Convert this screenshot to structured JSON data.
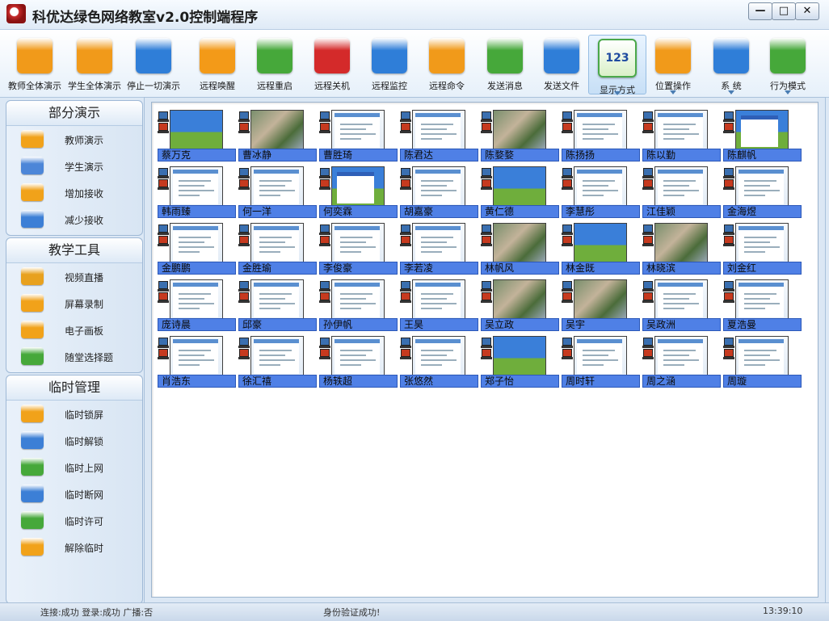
{
  "window": {
    "title": "科优达绿色网络教室v2.0控制端程序",
    "controls": {
      "minimize": "—",
      "maximize": "□",
      "close": "✕"
    }
  },
  "toolbar": [
    {
      "label": "教师全体演示",
      "icon": "teacher-broadcast-icon",
      "color": "#f19a1a"
    },
    {
      "label": "学生全体演示",
      "icon": "student-broadcast-icon",
      "color": "#f19a1a"
    },
    {
      "label": "停止一切演示",
      "icon": "stop-all-icon",
      "color": "#2f7ed8"
    },
    {
      "label": "远程唤醒",
      "icon": "wake-icon",
      "color": "#f39a18"
    },
    {
      "label": "远程重启",
      "icon": "restart-icon",
      "color": "#46a83a"
    },
    {
      "label": "远程关机",
      "icon": "shutdown-icon",
      "color": "#d42a2a"
    },
    {
      "label": "远程监控",
      "icon": "monitor-icon",
      "color": "#2f7ed8"
    },
    {
      "label": "远程命令",
      "icon": "command-icon",
      "color": "#f19a1a"
    },
    {
      "label": "发送消息",
      "icon": "message-icon",
      "color": "#46a83a"
    },
    {
      "label": "发送文件",
      "icon": "file-icon",
      "color": "#2f7ed8"
    },
    {
      "label": "显示方式",
      "icon": "display-mode-icon",
      "color": "#4aa84a",
      "active": true,
      "dropdown": true,
      "text": "123"
    },
    {
      "label": "位置操作",
      "icon": "position-icon",
      "color": "#f19a1a",
      "dropdown": true
    },
    {
      "label": "系  统",
      "icon": "system-icon",
      "color": "#2f7ed8",
      "dropdown": true
    },
    {
      "label": "行为模式",
      "icon": "behavior-icon",
      "color": "#46a83a",
      "dropdown": true
    }
  ],
  "sidebar": {
    "sections": [
      {
        "title": "部分演示",
        "items": [
          {
            "label": "教师演示",
            "icon": "teacher-demo-icon",
            "color": "#f1a21a"
          },
          {
            "label": "学生演示",
            "icon": "student-demo-icon",
            "color": "#4c86d8"
          },
          {
            "label": "增加接收",
            "icon": "add-receive-icon",
            "color": "#f1a21a"
          },
          {
            "label": "减少接收",
            "icon": "reduce-receive-icon",
            "color": "#3c7fd6"
          }
        ]
      },
      {
        "title": "教学工具",
        "items": [
          {
            "label": "视频直播",
            "icon": "video-live-icon",
            "color": "#e8a11e"
          },
          {
            "label": "屏幕录制",
            "icon": "screen-record-icon",
            "color": "#f1a21a"
          },
          {
            "label": "电子画板",
            "icon": "drawing-board-icon",
            "color": "#f1a21a"
          },
          {
            "label": "随堂选择题",
            "icon": "quiz-icon",
            "color": "#46a83a"
          }
        ]
      },
      {
        "title": "临时管理",
        "items": [
          {
            "label": "临时锁屏",
            "icon": "lock-screen-icon",
            "color": "#f1a21a"
          },
          {
            "label": "临时解锁",
            "icon": "unlock-icon",
            "color": "#3c7fd6"
          },
          {
            "label": "临时上网",
            "icon": "internet-on-icon",
            "color": "#46a83a"
          },
          {
            "label": "临时断网",
            "icon": "internet-off-icon",
            "color": "#3c7fd6"
          },
          {
            "label": "临时许可",
            "icon": "permit-icon",
            "color": "#46a83a"
          },
          {
            "label": "解除临时",
            "icon": "release-icon",
            "color": "#f1a21a"
          }
        ]
      }
    ]
  },
  "students": [
    {
      "name": "蔡万克",
      "screen": "xp"
    },
    {
      "name": "曹冰静",
      "screen": "photo"
    },
    {
      "name": "曹胜琦",
      "screen": "web"
    },
    {
      "name": "陈君达",
      "screen": "web"
    },
    {
      "name": "陈婺婺",
      "screen": "photo"
    },
    {
      "name": "陈扬扬",
      "screen": "web"
    },
    {
      "name": "陈以勤",
      "screen": "web"
    },
    {
      "name": "陈麒帆",
      "screen": "xp"
    },
    {
      "name": "韩雨臻",
      "screen": "web"
    },
    {
      "name": "何一洋",
      "screen": "web"
    },
    {
      "name": "何奕霖",
      "screen": "xp"
    },
    {
      "name": "胡嘉豪",
      "screen": "web"
    },
    {
      "name": "黄仁德",
      "screen": "xp"
    },
    {
      "name": "李慧彤",
      "screen": "web"
    },
    {
      "name": "江佳颖",
      "screen": "web"
    },
    {
      "name": "金海煜",
      "screen": "web"
    },
    {
      "name": "金鹏鹏",
      "screen": "web"
    },
    {
      "name": "金胜瑜",
      "screen": "web"
    },
    {
      "name": "李俊豪",
      "screen": "web"
    },
    {
      "name": "李若凌",
      "screen": "web"
    },
    {
      "name": "林帆风",
      "screen": "photo"
    },
    {
      "name": "林金既",
      "screen": "xp"
    },
    {
      "name": "林晓滨",
      "screen": "photo"
    },
    {
      "name": "刘金红",
      "screen": "web"
    },
    {
      "name": "庞诗晨",
      "screen": "web"
    },
    {
      "name": "邱豪",
      "screen": "web"
    },
    {
      "name": "孙伊帆",
      "screen": "web"
    },
    {
      "name": "王昊",
      "screen": "web"
    },
    {
      "name": "吴立政",
      "screen": "photo"
    },
    {
      "name": "吴宇",
      "screen": "photo"
    },
    {
      "name": "吴政洲",
      "screen": "web"
    },
    {
      "name": "夏浩曼",
      "screen": "web"
    },
    {
      "name": "肖浩东",
      "screen": "web"
    },
    {
      "name": "徐汇禧",
      "screen": "web"
    },
    {
      "name": "杨轶超",
      "screen": "web"
    },
    {
      "name": "张悠然",
      "screen": "web"
    },
    {
      "name": "郑子怡",
      "screen": "xp"
    },
    {
      "name": "周时轩",
      "screen": "web"
    },
    {
      "name": "周之涵",
      "screen": "web"
    },
    {
      "name": "周璇",
      "screen": "web"
    }
  ],
  "statusbar": {
    "connection": "连接:成功  登录:成功  广播:否",
    "auth": "身份验证成功!",
    "time": "13:39:10"
  }
}
